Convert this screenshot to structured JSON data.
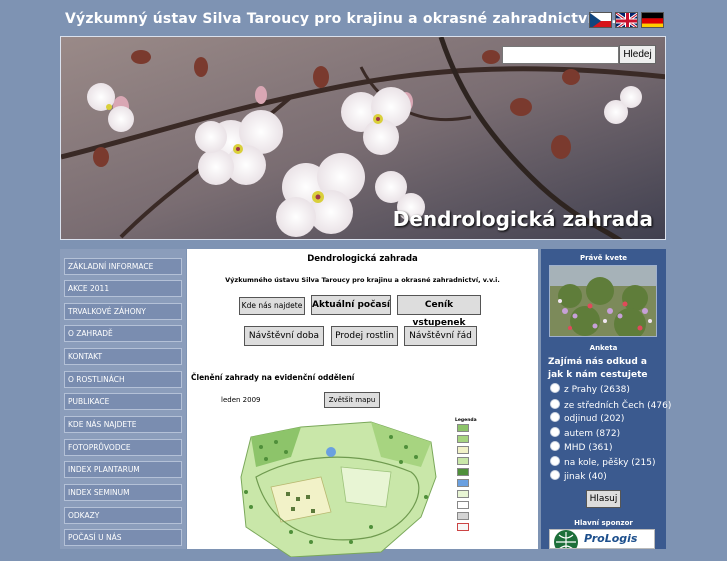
{
  "header": {
    "title": "Výzkumný ústav Silva Taroucy pro krajinu a okrasné zahradnictví, v.v.i",
    "flags": [
      "cz-flag-icon",
      "uk-flag-icon",
      "de-flag-icon"
    ]
  },
  "search": {
    "placeholder": "",
    "button_label": "Hledej"
  },
  "banner": {
    "title": "Dendrologická zahrada"
  },
  "sidebar": {
    "items": [
      {
        "label": "ZÁKLADNÍ INFORMACE"
      },
      {
        "label": "AKCE 2011"
      },
      {
        "label": "TRVALKOVÉ ZÁHONY"
      },
      {
        "label": "O ZAHRADĚ"
      },
      {
        "label": "KONTAKT"
      },
      {
        "label": "O ROSTLINÁCH"
      },
      {
        "label": "PUBLIKACE"
      },
      {
        "label": "KDE NÁS NAJDETE"
      },
      {
        "label": "FOTOPRŮVODCE"
      },
      {
        "label": "INDEX PLANTARUM"
      },
      {
        "label": "INDEX SEMINUM"
      },
      {
        "label": "ODKAZY"
      },
      {
        "label": "POČASÍ U NÁS"
      }
    ]
  },
  "main": {
    "title": "Dendrologická zahrada",
    "subtitle": "Výzkumného ústavu Silva Taroucy pro krajinu a okrasné zahradnictví, v.v.i.",
    "buttons_row1": [
      "Kde nás najdete",
      "Aktuální počasí",
      "Ceník vstupenek"
    ],
    "buttons_row2": [
      "Návštěvní doba",
      "Prodej rostlin",
      "Návštěvní řád"
    ],
    "section_title": "Členění zahrady na evidenční oddělení",
    "map_date": "leden 2009",
    "zoom_button": "Zvětšit mapu",
    "legend_title": "Legenda"
  },
  "right": {
    "blooming_label": "Právě kvete",
    "poll_title": "Anketa",
    "poll_question": "Zajímá nás odkud a jak k nám cestujete",
    "poll_options": [
      {
        "label": "z Prahy (2638)"
      },
      {
        "label": "ze středních Čech (476)"
      },
      {
        "label": "odjinud (202)"
      },
      {
        "label": "autem (872)"
      },
      {
        "label": "MHD (361)"
      },
      {
        "label": "na kole, pěšky (215)"
      },
      {
        "label": "jinak (40)"
      }
    ],
    "vote_button": "Hlasuj",
    "sponsor_label": "Hlavní sponzor",
    "sponsor_name": "ProLogis"
  },
  "colors": {
    "page_bg": "#7e93b3",
    "nav_bg": "#7a8db0",
    "right_bg": "#3b5a8f"
  }
}
